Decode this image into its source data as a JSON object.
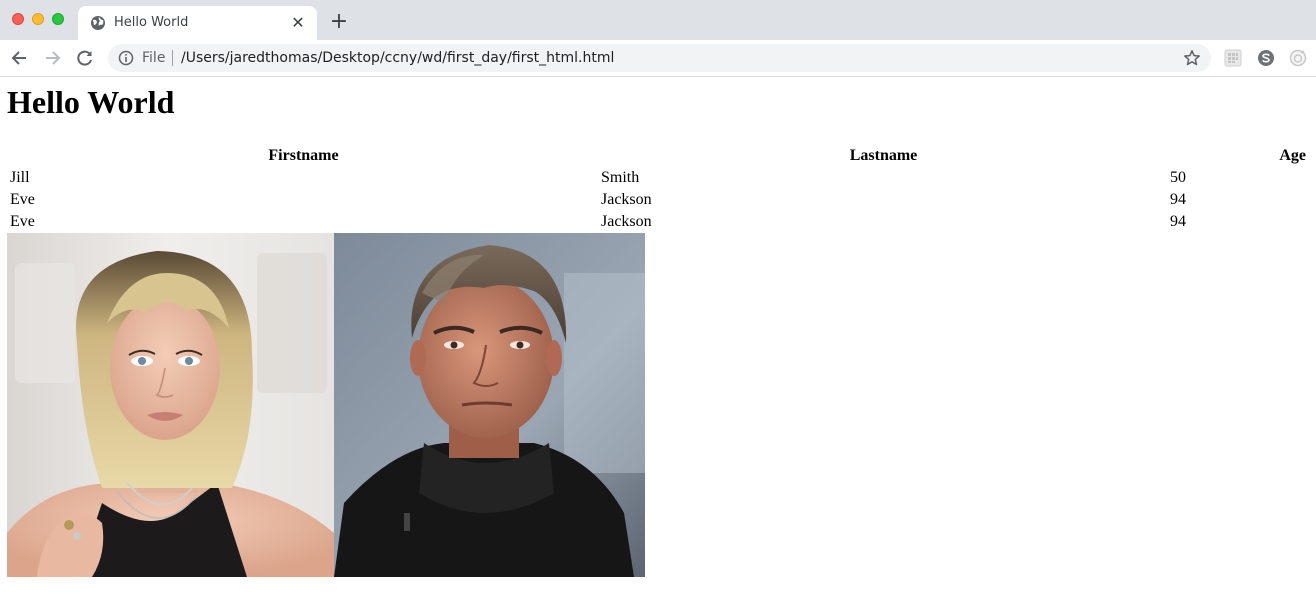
{
  "browser": {
    "tab_title": "Hello World",
    "tab_close": "✕",
    "new_tab": "+",
    "scheme_label": "File",
    "url": "/Users/jaredthomas/Desktop/ccny/wd/first_day/first_html.html"
  },
  "page": {
    "heading": "Hello World",
    "table": {
      "headers": [
        "Firstname",
        "Lastname",
        "Age"
      ],
      "rows": [
        [
          "Jill",
          "Smith",
          "50"
        ],
        [
          "Eve",
          "Jackson",
          "94"
        ],
        [
          "Eve",
          "Jackson",
          "94"
        ]
      ]
    }
  },
  "colors": {
    "tabstrip": "#dee1e6",
    "omnibox": "#f1f3f4",
    "close_red": "#fd5f57",
    "minimize_yellow": "#febc2e",
    "zoom_green": "#28c840"
  }
}
